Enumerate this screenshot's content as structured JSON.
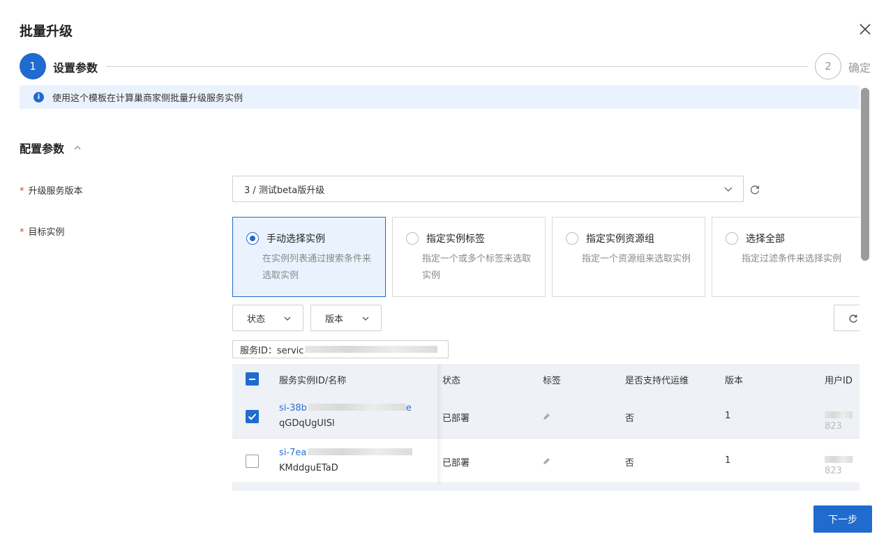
{
  "dialog": {
    "title": "批量升级"
  },
  "steps": [
    {
      "number": "1",
      "label": "设置参数"
    },
    {
      "number": "2",
      "label": "确定"
    }
  ],
  "info": {
    "text": "使用这个模板在计算巢商家侧批量升级服务实例"
  },
  "section": {
    "title": "配置参数"
  },
  "form": {
    "version_label": "升级服务版本",
    "version_value": "3 / 测试beta版升级",
    "target_label": "目标实例",
    "required_mark": "*"
  },
  "cards": [
    {
      "title": "手动选择实例",
      "desc": "在实例列表通过搜索条件来选取实例",
      "selected": true
    },
    {
      "title": "指定实例标签",
      "desc": "指定一个或多个标签来选取实例",
      "selected": false
    },
    {
      "title": "指定实例资源组",
      "desc": "指定一个资源组来选取实例",
      "selected": false
    },
    {
      "title": "选择全部",
      "desc": "指定过滤条件来选择实例",
      "selected": false
    }
  ],
  "filters": {
    "status": "状态",
    "version": "版本"
  },
  "chip": {
    "label": "服务ID：servic"
  },
  "table": {
    "headers": [
      "服务实例ID/名称",
      "状态",
      "标签",
      "是否支持代运维",
      "版本",
      "用户ID"
    ],
    "rows": [
      {
        "id": "si-38b",
        "id_tail": "e",
        "name": "qGDqUgUISl",
        "status": "已部署",
        "managed": "否",
        "version": "1",
        "user_id": "823",
        "checked": true
      },
      {
        "id": "si-7ea",
        "id_tail": "",
        "name": "KMddguETaD",
        "status": "已部署",
        "managed": "否",
        "version": "1",
        "user_id": "823",
        "checked": false
      }
    ]
  },
  "footer": {
    "next_label": "下一步"
  },
  "colors": {
    "primary": "#1f6bce",
    "info_bg": "#eaf3fd",
    "required": "#e0412a"
  }
}
